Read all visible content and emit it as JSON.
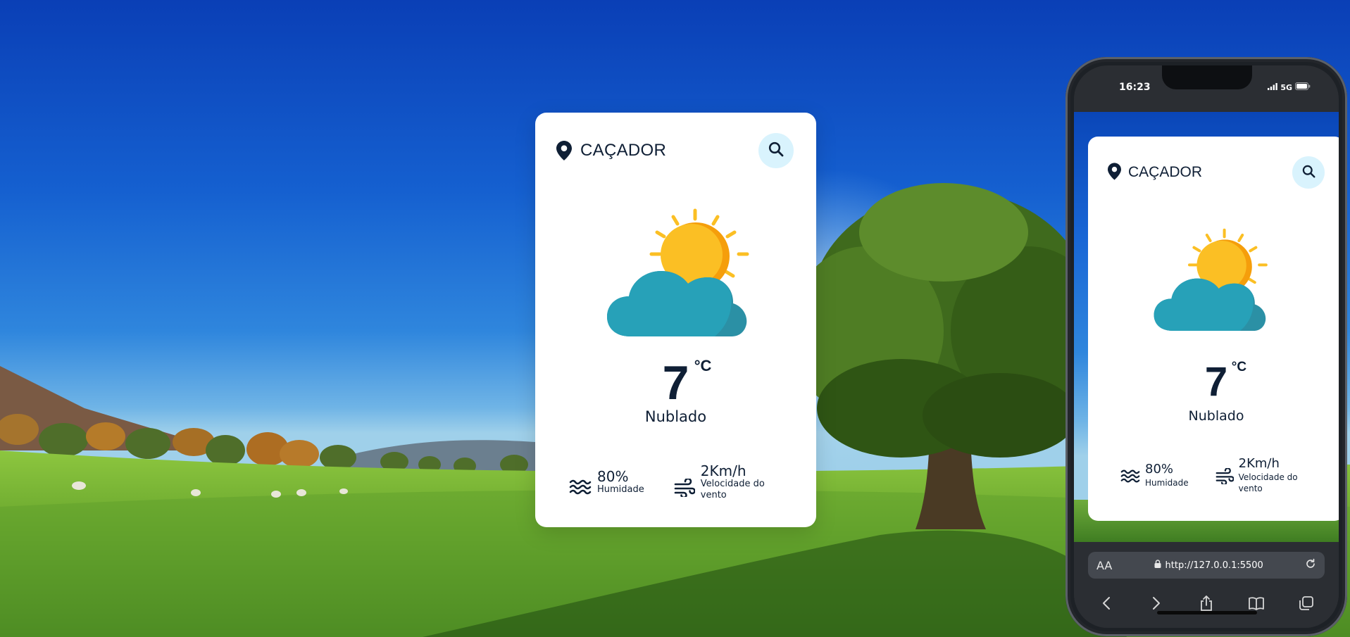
{
  "weather": {
    "city": "CAÇADOR",
    "temperature": "7",
    "unit": "°C",
    "description": "Nublado",
    "humidity_value": "80%",
    "humidity_label": "Humidade",
    "wind_value": "2Km/h",
    "wind_label_line1": "Velocidade do",
    "wind_label_line2": "vento"
  },
  "phone": {
    "time": "16:23",
    "network": "5G",
    "text_size_label": "AA",
    "url": "http://127.0.0.1:5500"
  },
  "icons": {
    "location": "location-pin-icon",
    "search": "search-icon",
    "weather": "partly-cloudy-icon",
    "humidity": "water-waves-icon",
    "wind": "wind-icon"
  },
  "colors": {
    "card_bg": "#ffffff",
    "text_dark": "#0f1f35",
    "search_bg": "#d9f3fd",
    "sun": "#fbbf24",
    "cloud": "#27a1b8"
  }
}
